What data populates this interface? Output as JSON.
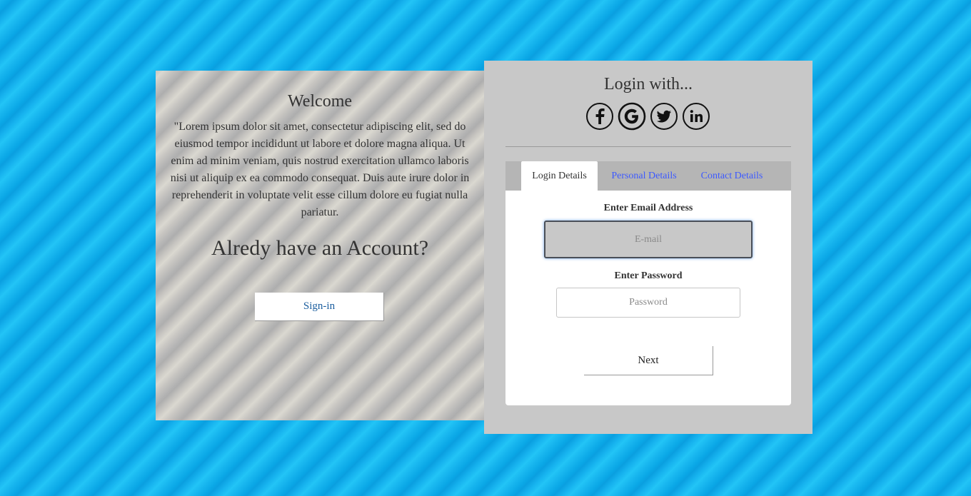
{
  "welcome_panel": {
    "title": "Welcome",
    "description": "\"Lorem ipsum dolor sit amet, consectetur adipiscing elit, sed do eiusmod tempor incididunt ut labore et dolore magna aliqua. Ut enim ad minim veniam, quis nostrud exercitation ullamco laboris nisi ut aliquip ex ea commodo consequat. Duis aute irure dolor in reprehenderit in voluptate velit esse cillum dolore eu fugiat nulla pariatur.",
    "account_prompt": "Alredy have an Account?",
    "signin_label": "Sign-in"
  },
  "login_panel": {
    "login_with": "Login with...",
    "social_icons": [
      "facebook-icon",
      "google-icon",
      "twitter-icon",
      "linkedin-icon"
    ],
    "tabs": [
      {
        "label": "Login Details",
        "active": true
      },
      {
        "label": "Personal Details",
        "active": false
      },
      {
        "label": "Contact Details",
        "active": false
      }
    ],
    "email_label": "Enter Email Address",
    "email_placeholder": "E-mail",
    "email_value": "",
    "password_label": "Enter Password",
    "password_placeholder": "Password",
    "password_value": "",
    "next_label": "Next"
  },
  "colors": {
    "background_stripe": "#18b6ef",
    "tab_link": "#3d5aff",
    "panel_gray": "#c8c8c8",
    "signin_text": "#1a5d9e"
  }
}
